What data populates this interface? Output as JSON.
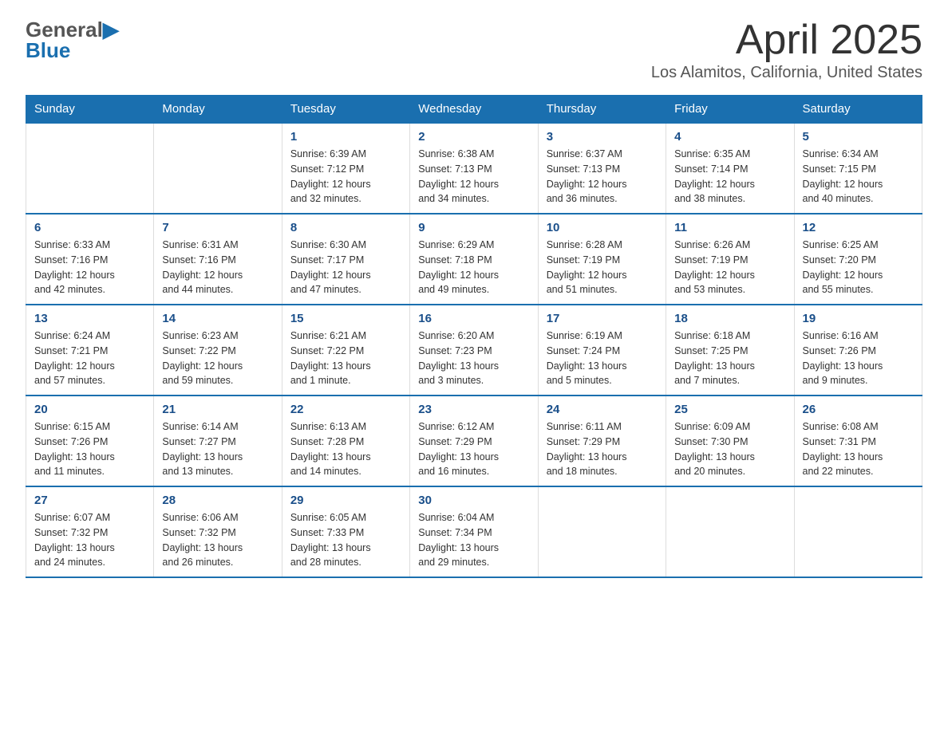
{
  "header": {
    "logo_general": "General",
    "logo_blue": "Blue",
    "month_title": "April 2025",
    "location": "Los Alamitos, California, United States"
  },
  "days_of_week": [
    "Sunday",
    "Monday",
    "Tuesday",
    "Wednesday",
    "Thursday",
    "Friday",
    "Saturday"
  ],
  "weeks": [
    [
      {
        "day": "",
        "info": ""
      },
      {
        "day": "",
        "info": ""
      },
      {
        "day": "1",
        "info": "Sunrise: 6:39 AM\nSunset: 7:12 PM\nDaylight: 12 hours\nand 32 minutes."
      },
      {
        "day": "2",
        "info": "Sunrise: 6:38 AM\nSunset: 7:13 PM\nDaylight: 12 hours\nand 34 minutes."
      },
      {
        "day": "3",
        "info": "Sunrise: 6:37 AM\nSunset: 7:13 PM\nDaylight: 12 hours\nand 36 minutes."
      },
      {
        "day": "4",
        "info": "Sunrise: 6:35 AM\nSunset: 7:14 PM\nDaylight: 12 hours\nand 38 minutes."
      },
      {
        "day": "5",
        "info": "Sunrise: 6:34 AM\nSunset: 7:15 PM\nDaylight: 12 hours\nand 40 minutes."
      }
    ],
    [
      {
        "day": "6",
        "info": "Sunrise: 6:33 AM\nSunset: 7:16 PM\nDaylight: 12 hours\nand 42 minutes."
      },
      {
        "day": "7",
        "info": "Sunrise: 6:31 AM\nSunset: 7:16 PM\nDaylight: 12 hours\nand 44 minutes."
      },
      {
        "day": "8",
        "info": "Sunrise: 6:30 AM\nSunset: 7:17 PM\nDaylight: 12 hours\nand 47 minutes."
      },
      {
        "day": "9",
        "info": "Sunrise: 6:29 AM\nSunset: 7:18 PM\nDaylight: 12 hours\nand 49 minutes."
      },
      {
        "day": "10",
        "info": "Sunrise: 6:28 AM\nSunset: 7:19 PM\nDaylight: 12 hours\nand 51 minutes."
      },
      {
        "day": "11",
        "info": "Sunrise: 6:26 AM\nSunset: 7:19 PM\nDaylight: 12 hours\nand 53 minutes."
      },
      {
        "day": "12",
        "info": "Sunrise: 6:25 AM\nSunset: 7:20 PM\nDaylight: 12 hours\nand 55 minutes."
      }
    ],
    [
      {
        "day": "13",
        "info": "Sunrise: 6:24 AM\nSunset: 7:21 PM\nDaylight: 12 hours\nand 57 minutes."
      },
      {
        "day": "14",
        "info": "Sunrise: 6:23 AM\nSunset: 7:22 PM\nDaylight: 12 hours\nand 59 minutes."
      },
      {
        "day": "15",
        "info": "Sunrise: 6:21 AM\nSunset: 7:22 PM\nDaylight: 13 hours\nand 1 minute."
      },
      {
        "day": "16",
        "info": "Sunrise: 6:20 AM\nSunset: 7:23 PM\nDaylight: 13 hours\nand 3 minutes."
      },
      {
        "day": "17",
        "info": "Sunrise: 6:19 AM\nSunset: 7:24 PM\nDaylight: 13 hours\nand 5 minutes."
      },
      {
        "day": "18",
        "info": "Sunrise: 6:18 AM\nSunset: 7:25 PM\nDaylight: 13 hours\nand 7 minutes."
      },
      {
        "day": "19",
        "info": "Sunrise: 6:16 AM\nSunset: 7:26 PM\nDaylight: 13 hours\nand 9 minutes."
      }
    ],
    [
      {
        "day": "20",
        "info": "Sunrise: 6:15 AM\nSunset: 7:26 PM\nDaylight: 13 hours\nand 11 minutes."
      },
      {
        "day": "21",
        "info": "Sunrise: 6:14 AM\nSunset: 7:27 PM\nDaylight: 13 hours\nand 13 minutes."
      },
      {
        "day": "22",
        "info": "Sunrise: 6:13 AM\nSunset: 7:28 PM\nDaylight: 13 hours\nand 14 minutes."
      },
      {
        "day": "23",
        "info": "Sunrise: 6:12 AM\nSunset: 7:29 PM\nDaylight: 13 hours\nand 16 minutes."
      },
      {
        "day": "24",
        "info": "Sunrise: 6:11 AM\nSunset: 7:29 PM\nDaylight: 13 hours\nand 18 minutes."
      },
      {
        "day": "25",
        "info": "Sunrise: 6:09 AM\nSunset: 7:30 PM\nDaylight: 13 hours\nand 20 minutes."
      },
      {
        "day": "26",
        "info": "Sunrise: 6:08 AM\nSunset: 7:31 PM\nDaylight: 13 hours\nand 22 minutes."
      }
    ],
    [
      {
        "day": "27",
        "info": "Sunrise: 6:07 AM\nSunset: 7:32 PM\nDaylight: 13 hours\nand 24 minutes."
      },
      {
        "day": "28",
        "info": "Sunrise: 6:06 AM\nSunset: 7:32 PM\nDaylight: 13 hours\nand 26 minutes."
      },
      {
        "day": "29",
        "info": "Sunrise: 6:05 AM\nSunset: 7:33 PM\nDaylight: 13 hours\nand 28 minutes."
      },
      {
        "day": "30",
        "info": "Sunrise: 6:04 AM\nSunset: 7:34 PM\nDaylight: 13 hours\nand 29 minutes."
      },
      {
        "day": "",
        "info": ""
      },
      {
        "day": "",
        "info": ""
      },
      {
        "day": "",
        "info": ""
      }
    ]
  ]
}
